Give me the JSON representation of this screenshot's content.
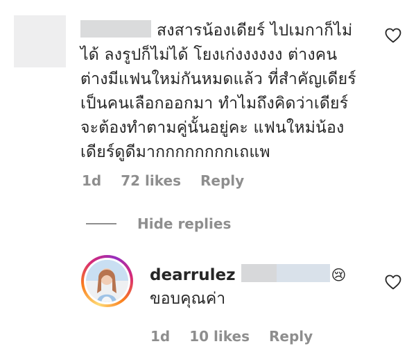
{
  "comment": {
    "text_lines": [
      "สงสารน้องเดียร์ ไปเมกาก็ไม่",
      "ได้ ลงรูปก็ไม่ได้ โยงเก่งงงงงง ต่างคน",
      "ต่างมีแฟนใหม่กันหมดแล้ว ที่สำคัญเดียร์",
      "เป็นคนเลือกออกมา ทำไมถึงคิดว่าเดียร์",
      "จะต้องทำตามคู่นั้นอยู่คะ แฟนใหม่น้อง",
      "เดียร์ดูดีมากกกกกกกกเถแพ"
    ],
    "time": "1d",
    "likes": "72 likes",
    "reply_label": "Reply"
  },
  "hide_replies_label": "Hide replies",
  "reply": {
    "author": "dearrulez",
    "emoji": "😢",
    "text": "ขอบคุณค่า",
    "time": "1d",
    "likes": "10 likes",
    "reply_label": "Reply"
  }
}
